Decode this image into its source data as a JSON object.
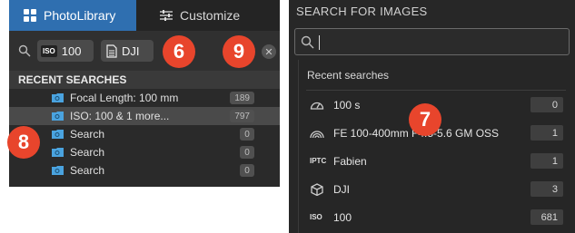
{
  "left_panel": {
    "tabs": [
      {
        "label": "PhotoLibrary",
        "icon": "grid-icon",
        "active": true
      },
      {
        "label": "Customize",
        "icon": "sliders-icon",
        "active": false
      }
    ],
    "search_chips": [
      {
        "icon": "iso-badge",
        "badge_text": "ISO",
        "value": "100"
      },
      {
        "icon": "document-icon",
        "value": "DJI"
      }
    ],
    "recent_header": "RECENT SEARCHES",
    "recent_items": [
      {
        "label": "Focal Length: 100 mm",
        "count": "189",
        "selected": false
      },
      {
        "label": "ISO: 100 & 1 more...",
        "count": "797",
        "selected": true
      },
      {
        "label": "Search",
        "count": "0",
        "selected": false
      },
      {
        "label": "Search",
        "count": "0",
        "selected": false
      },
      {
        "label": "Search",
        "count": "0",
        "selected": false
      }
    ]
  },
  "callouts": [
    "6",
    "9",
    "8",
    "7"
  ],
  "right_panel": {
    "title": "SEARCH FOR IMAGES",
    "search_value": "",
    "recent_label": "Recent searches",
    "items": [
      {
        "icon": "shutter-speed-icon",
        "label": "100 s",
        "count": "0"
      },
      {
        "icon": "lens-icon",
        "label": "FE 100-400mm F4.5-5.6 GM OSS",
        "count": "1"
      },
      {
        "icon": "iptc-icon",
        "icon_text": "IPTC",
        "label": "Fabien",
        "count": "1"
      },
      {
        "icon": "cube-icon",
        "label": "DJI",
        "count": "3"
      },
      {
        "icon": "iso-icon",
        "icon_text": "ISO",
        "label": "100",
        "count": "681"
      }
    ]
  },
  "colors": {
    "accent": "#2f6fb0",
    "callout": "#e8452c",
    "folder": "#4aa3df"
  }
}
